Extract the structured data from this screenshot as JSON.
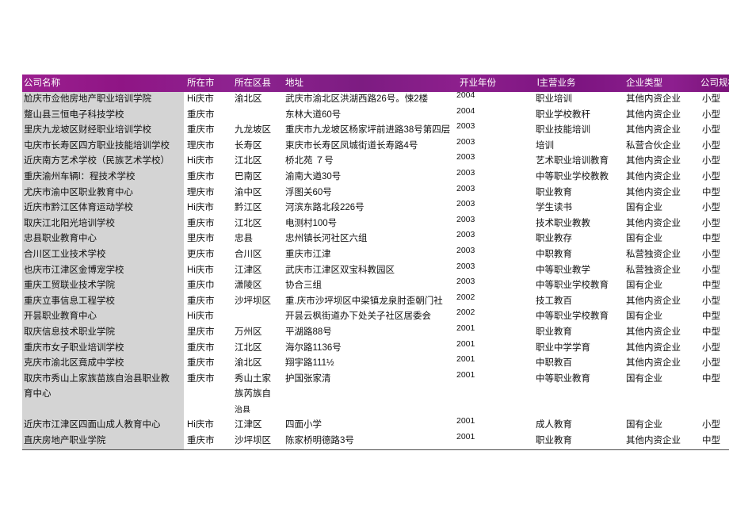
{
  "table": {
    "columns": [
      {
        "key": "name",
        "label": "公司名称"
      },
      {
        "key": "city",
        "label": "所在市"
      },
      {
        "key": "district",
        "label": "所在区县"
      },
      {
        "key": "address",
        "label": "地址"
      },
      {
        "key": "year",
        "label": "开业年份"
      },
      {
        "key": "business",
        "label": "l主营业务"
      },
      {
        "key": "type",
        "label": "企业类型"
      },
      {
        "key": "size",
        "label": "公司规模"
      }
    ],
    "header_color": "#8d1f8d",
    "name_column_fill": "#d4d4d4",
    "rows": [
      {
        "name": "尬庆市佥他房地产职业培训学院",
        "city": "Hi庆市",
        "district": "渝北区",
        "address": "武庆市渝北区洪湖西路26号。悚2楼",
        "year": "2004",
        "business": "职业培训",
        "type": "其他内资企业",
        "size": "小型"
      },
      {
        "name": "蹩山县三恒电子科技学校",
        "city": "重庆市",
        "district": "",
        "address": "东林大道60号",
        "year": "2004",
        "business": "职业学校教秆",
        "type": "其他内资企业",
        "size": "小型"
      },
      {
        "name": "里庆九龙坡区财经职业培训学校",
        "city": "重庆市",
        "district": "九龙坡区",
        "address": "重庆市九龙坡区杨家坪前进路38号第四层",
        "year": "2003",
        "business": "职业技能培训",
        "type": "其他内资企业",
        "size": "小型"
      },
      {
        "name": "屯庆市长寿区四方职业技能培训学校",
        "city": "理庆市",
        "district": "长寿区",
        "address": "束庆市长寿区凤城街道长寿路4号",
        "year": "2003",
        "business": "培训",
        "type": "私营合伙企业",
        "size": "小型"
      },
      {
        "name": "近庆南方艺术学校（民族艺术学校）",
        "city": "Hi庆市",
        "district": "江北区",
        "address": "桥北苑 ７号",
        "year": "2003",
        "business": "艺术职业培训教育",
        "type": "其他内资企业",
        "size": "小型"
      },
      {
        "name": "重庆渝州车辆l：程技术学校",
        "city": "重庆市",
        "district": "巴南区",
        "address": "渝南大遒30号",
        "year": "2003",
        "business": "中等职业学校教教",
        "type": "其他内资企业",
        "size": "小型"
      },
      {
        "name": "尤庆市渝中区职业教育中心",
        "city": "理庆市",
        "district": "渝中区",
        "address": "浮图关60号",
        "year": "2003",
        "business": "职业教育",
        "type": "其他内资企业",
        "size": "中型"
      },
      {
        "name": "近庆市黔江区体育运动学校",
        "city": "Hi庆市",
        "district": "黔江区",
        "address": "河滨东路北段226号",
        "year": "2003",
        "business": "学生读书",
        "type": "国有企业",
        "size": "小型"
      },
      {
        "name": "取庆江北阳光培训学校",
        "city": "重庆市",
        "district": "江北区",
        "address": "电测村100号",
        "year": "2003",
        "business": "技术职业教教",
        "type": "其他内资企业",
        "size": "小型"
      },
      {
        "name": "忠县职业教育中心",
        "city": "里庆市",
        "district": "忠县",
        "address": "忠州镇长河社区六组",
        "year": "2003",
        "business": "职业教存",
        "type": "国有企业",
        "size": "中型"
      },
      {
        "name": "合川区工业技术学校",
        "city": "更庆市",
        "district": "合川区",
        "address": "重庆市江津",
        "year": "2003",
        "business": "中职教育",
        "type": "私营独资企业",
        "size": "小型"
      },
      {
        "name": "也庆市江津区金博宠学校",
        "city": "Hi庆市",
        "district": "江津区",
        "address": "武庆市江津区双宝科教园区",
        "year": "2003",
        "business": "中等职业教学",
        "type": "私营独资企业",
        "size": "小型"
      },
      {
        "name": "重庆工贸联业技术学院",
        "city": "重庆巾",
        "district": "潇陵区",
        "address": "协合三组",
        "year": "2003",
        "business": "中等职业学校教育",
        "type": "国有企业",
        "size": "中型"
      },
      {
        "name": "重庆立事信息工程学校",
        "city": "重庆市",
        "district": "沙坪坝区",
        "address": "重.庆市沙坪坝区中梁镇龙泉肘歪朝门社",
        "year": "2002",
        "business": "技工教百",
        "type": "其他内资企业",
        "size": "小型"
      },
      {
        "name": "开昙职业教育中心",
        "city": "Hi庆市",
        "district": "",
        "address": "开昙云枫街道办下处关子社区居委会",
        "year": "2002",
        "business": "中等职业学校教育",
        "type": "国有企业",
        "size": "中型"
      },
      {
        "name": "取庆信息技术职业学院",
        "city": "里庆市",
        "district": "万州区",
        "address": "平湖路88号",
        "year": "2001",
        "business": "职业教育",
        "type": "其他内资企业",
        "size": "中型"
      },
      {
        "name": "重庆市女子职业培训学校",
        "city": "重庆市",
        "district": "江北区",
        "address": "海尔路1136号",
        "year": "2001",
        "business": "职业中学学育",
        "type": "其他内资企业",
        "size": "小型"
      },
      {
        "name": "克庆市渝北区竟成中学校",
        "city": "重庆市",
        "district": "渝北区",
        "address": "翔宇路111½",
        "year": "2001",
        "business": "中职教百",
        "type": "其他内资企业",
        "size": "小型"
      },
      {
        "name": "取庆市秀山上家族苗族自治县职业教育中心",
        "name_line1": "取庆市秀山上家族苗族自治县职业教",
        "name_line2": "育中心",
        "city": "重庆市",
        "district": "秀山土家族芮族自治县",
        "district_line1": "秀山土家",
        "district_line2": "族芮族自",
        "district_line3": "治县",
        "address": "护国张家清",
        "year": "2001",
        "business": "中等职业教育",
        "type": "国有企业",
        "size": "中型"
      },
      {
        "name": "近庆市江津区四面山成人教育中心",
        "city": "Hi庆市",
        "district": "江津区",
        "address": "四面小学",
        "year": "2001",
        "business": "成人教育",
        "type": "国有企业",
        "size": "小型"
      },
      {
        "name": "直庆房地产职业学院",
        "city": "重庆市",
        "district": "沙坪坝区",
        "address": "陈家桥明德路3号",
        "year": "2001",
        "business": "职业教育",
        "type": "其他内资企业",
        "size": "中型"
      }
    ]
  }
}
